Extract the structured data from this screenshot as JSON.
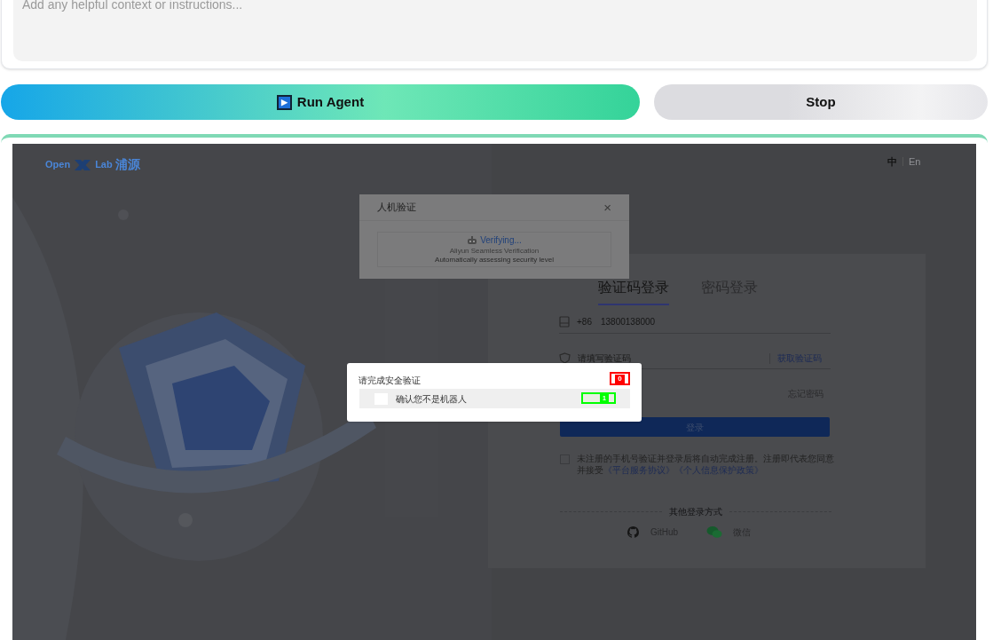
{
  "context_field": {
    "placeholder": "Add any helpful context or instructions..."
  },
  "buttons": [
    {
      "kind": "run",
      "icon": "▶",
      "label": "Run Agent"
    },
    {
      "kind": "stop",
      "label": "Stop"
    }
  ],
  "screenshot": {
    "logo": {
      "left": "Open",
      "right": "Lab",
      "name": "浦源"
    },
    "language": [
      {
        "label": "中",
        "selected": true
      },
      {
        "label": "En",
        "selected": false
      }
    ],
    "captcha_dialog": {
      "title": "人机验证",
      "close": "×",
      "status": "Verifying...",
      "provider": "Aliyun Seamless Verification",
      "note": "Automatically assessing security level"
    },
    "login_tabs": [
      {
        "label": "验证码登录",
        "selected": true
      },
      {
        "label": "密码登录",
        "selected": false
      }
    ],
    "phone": {
      "prefix": "+86",
      "value": "13800138000"
    },
    "code_field": {
      "placeholder": "请填写验证码",
      "action": "获取验证码"
    },
    "forgot": "忘记密码",
    "login_button": "登录",
    "agreement": {
      "checked": false,
      "text": "未注册的手机号验证并登录后将自动完成注册。注册即代表您同意并接受",
      "links": [
        "《平台服务协议》",
        "《个人信息保护政策》"
      ]
    },
    "other_methods": "其他登录方式",
    "social": [
      {
        "kind": "github",
        "label": "GitHub"
      },
      {
        "kind": "wechat",
        "label": "微信"
      }
    ],
    "security_popup": {
      "title": "请完成安全验证",
      "checkbox_label": "确认您不是机器人",
      "checked": false
    },
    "marks": [
      {
        "label": "0",
        "color": "#ff0000"
      },
      {
        "label": "1",
        "color": "#00ff00"
      }
    ]
  }
}
